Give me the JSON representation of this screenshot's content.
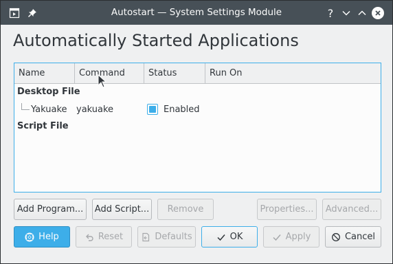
{
  "window": {
    "title": "Autostart — System Settings Module"
  },
  "titlebar_buttons": {
    "help": "?"
  },
  "heading": "Automatically Started Applications",
  "columns": [
    "Name",
    "Command",
    "Status",
    "Run On"
  ],
  "groups": {
    "desktop_file": "Desktop File",
    "script_file": "Script File"
  },
  "entries": [
    {
      "name": "Yakuake",
      "command": "yakuake",
      "status": "Enabled",
      "enabled": true,
      "run_on": ""
    }
  ],
  "action_buttons": {
    "add_program": "Add Program...",
    "add_script": "Add Script...",
    "remove": "Remove",
    "properties": "Properties...",
    "advanced": "Advanced..."
  },
  "dialog_buttons": {
    "help": "Help",
    "reset": "Reset",
    "defaults": "Defaults",
    "ok": "OK",
    "apply": "Apply",
    "cancel": "Cancel"
  },
  "colors": {
    "titlebar": "#475057",
    "accent": "#3daee9",
    "window_bg": "#eff0f1",
    "list_bg": "#fcfcfc",
    "text": "#31363b",
    "disabled_text": "#a6a8ab"
  },
  "icons": {
    "window_menu": "window-menu-icon",
    "pin": "pin-icon",
    "help": "question-icon",
    "minimize": "chevron-down-icon",
    "maximize": "chevron-up-icon",
    "close": "close-icon",
    "help_button": "lifebuoy-icon",
    "reset": "undo-icon",
    "defaults": "document-revert-icon",
    "ok": "checkmark-icon",
    "apply": "checkmark-icon",
    "cancel": "cancel-icon"
  }
}
